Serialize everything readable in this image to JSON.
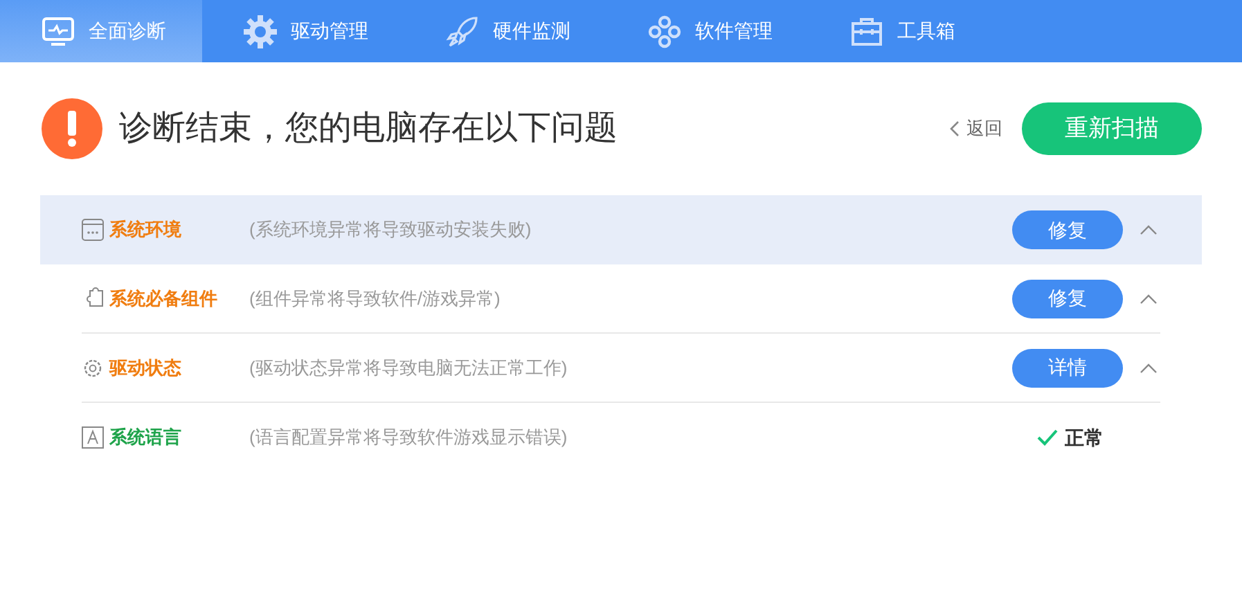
{
  "tabs": [
    {
      "label": "全面诊断",
      "selected": true
    },
    {
      "label": "驱动管理",
      "selected": false
    },
    {
      "label": "硬件监测",
      "selected": false
    },
    {
      "label": "软件管理",
      "selected": false
    },
    {
      "label": "工具箱",
      "selected": false
    }
  ],
  "header": {
    "title": "诊断结束，您的电脑存在以下问题",
    "back": "返回",
    "rescan": "重新扫描"
  },
  "items": [
    {
      "kind": "issue",
      "name": "系统环境",
      "description": "(系统环境异常将导致驱动安装失败)",
      "action": "修复",
      "selected": true
    },
    {
      "kind": "issue",
      "name": "系统必备组件",
      "description": "(组件异常将导致软件/游戏异常)",
      "action": "修复",
      "selected": false
    },
    {
      "kind": "issue",
      "name": "驱动状态",
      "description": "(驱动状态异常将导致电脑无法正常工作)",
      "action": "详情",
      "selected": false
    },
    {
      "kind": "ok",
      "name": "系统语言",
      "description": "(语言配置异常将导致软件游戏显示错误)",
      "status": "正常",
      "selected": false
    }
  ]
}
